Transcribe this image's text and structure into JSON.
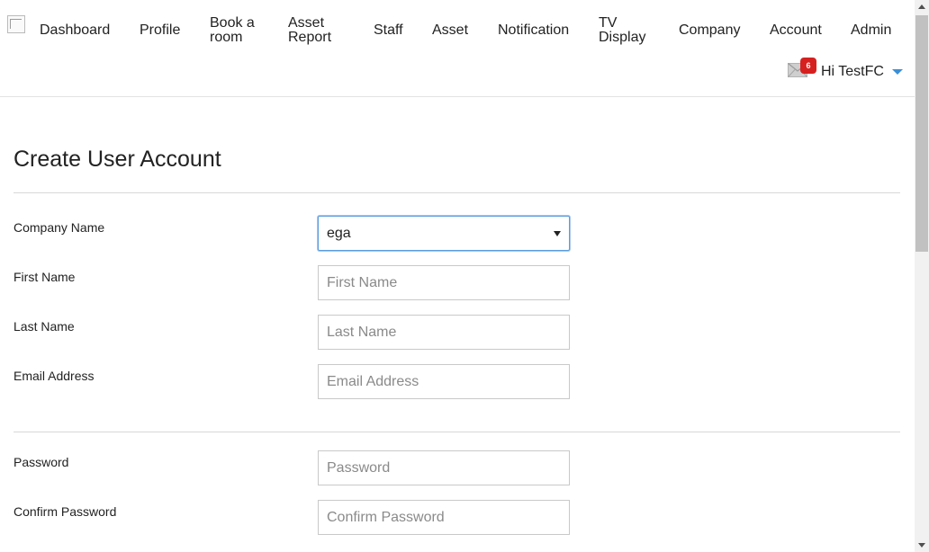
{
  "nav": {
    "items": [
      {
        "label": "Dashboard"
      },
      {
        "label": "Profile"
      },
      {
        "label": "Book a room"
      },
      {
        "label": "Asset Report"
      },
      {
        "label": "Staff"
      },
      {
        "label": "Asset"
      },
      {
        "label": "Notification"
      },
      {
        "label": "TV Display"
      },
      {
        "label": "Company"
      },
      {
        "label": "Account"
      },
      {
        "label": "Admin"
      }
    ],
    "notification_count": "6",
    "user_greeting": "Hi TestFC"
  },
  "page": {
    "title": "Create User Account"
  },
  "form": {
    "company_name": {
      "label": "Company Name",
      "value": "ega"
    },
    "first_name": {
      "label": "First Name",
      "placeholder": "First Name"
    },
    "last_name": {
      "label": "Last Name",
      "placeholder": "Last Name"
    },
    "email": {
      "label": "Email Address",
      "placeholder": "Email Address"
    },
    "password": {
      "label": "Password",
      "placeholder": "Password"
    },
    "confirm_password": {
      "label": "Confirm Password",
      "placeholder": "Confirm Password"
    }
  },
  "colors": {
    "badge": "#d62020",
    "caret": "#3b8fd6",
    "focus_border": "#5b9ddc"
  }
}
